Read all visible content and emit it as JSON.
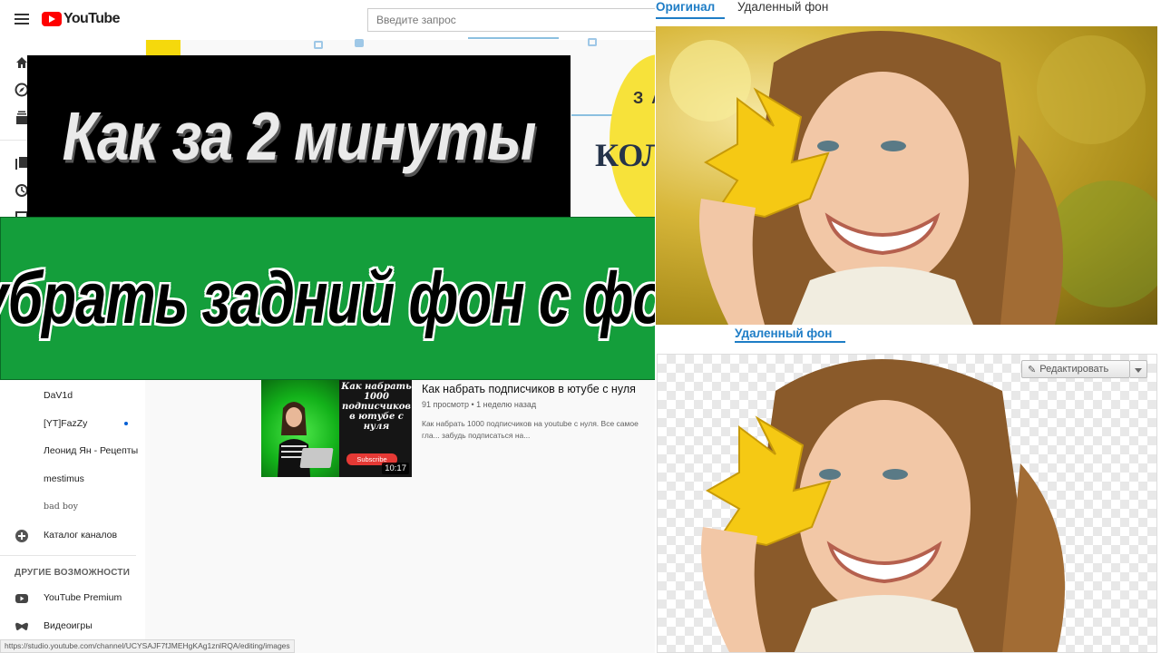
{
  "youtube": {
    "logo_text": "YouTube",
    "search_placeholder": "Введите запрос",
    "subscriptions": [
      "DaV1d",
      "[YT]FazZy",
      "Леонид Ян - Рецепты",
      "mestimus",
      "bad boy"
    ],
    "catalog_label": "Каталог каналов",
    "other_section_title": "ДРУГИЕ ВОЗМОЖНОСТИ",
    "other_items": [
      "YouTube Premium",
      "Видеоигры"
    ],
    "video": {
      "title": "Как набрать подписчиков в ютубе с нуля",
      "meta": "91 просмотр • 1 неделю назад",
      "description": "Как набрать 1000 подписчиков на youtube с нуля. Все самое гла... забудь подписаться на...",
      "duration": "10:17",
      "thumb_text": "Как набрать 1000 подписчиков в ютубе с нуля",
      "thumb_subscribe": "Subscribe"
    },
    "decor_za": "З А",
    "decor_kol": "КОЛ",
    "status_url": "https://studio.youtube.com/channel/UCYSAJF7fJMEHgKAg1znlRQA/editing/images"
  },
  "banner": {
    "line1": "Как за 2 минуты",
    "line2": "убрать задний фон с фото"
  },
  "tool": {
    "tabs": [
      "Оригинал",
      "Удаленный фон"
    ],
    "active_tab": "Оригинал",
    "section_label": "Удаленный фон",
    "edit_button": "Редактировать"
  },
  "colors": {
    "accent": "#1e7dc6",
    "banner_green": "#149e3b",
    "youtube_red": "#ff0000"
  }
}
